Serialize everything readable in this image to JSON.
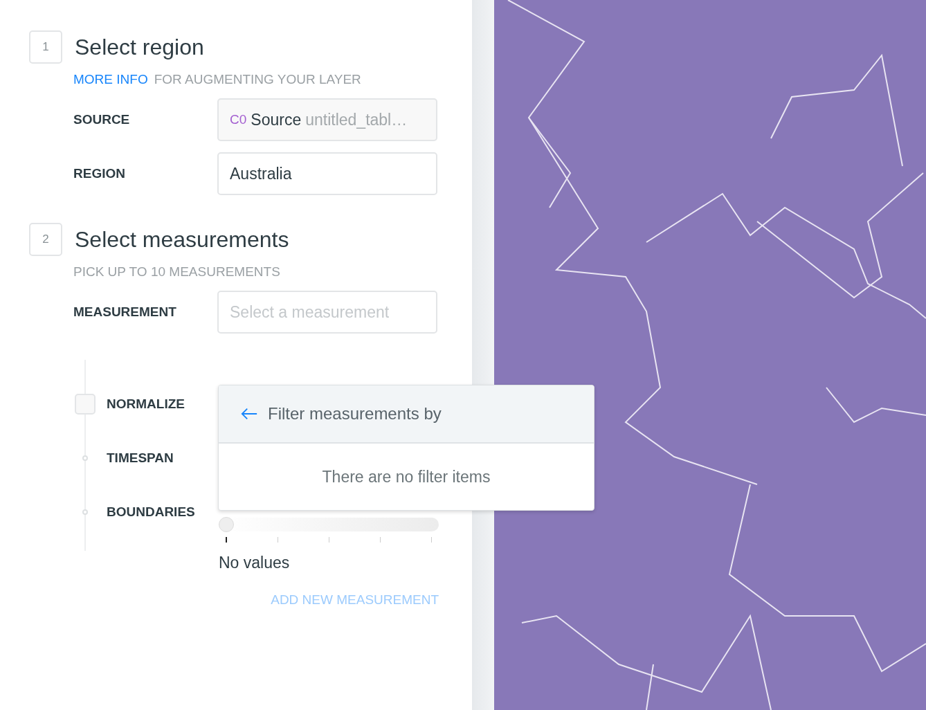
{
  "steps": [
    {
      "number": "1",
      "title": "Select region",
      "link": "MORE INFO",
      "subtitle": "FOR AUGMENTING YOUR LAYER",
      "fields": [
        {
          "label": "SOURCE",
          "kind": "source",
          "badge": "C0",
          "name": "Source",
          "value": "untitled_tabl…"
        },
        {
          "label": "REGION",
          "kind": "input",
          "value": "Australia"
        }
      ]
    },
    {
      "number": "2",
      "title": "Select measurements",
      "subtitle": "PICK UP TO 10 MEASUREMENTS",
      "fields": [
        {
          "label": "MEASUREMENT",
          "kind": "input",
          "placeholder": "Select a measurement"
        }
      ]
    }
  ],
  "options": [
    {
      "kind": "checkbox",
      "label": "NORMALIZE",
      "checked": false
    },
    {
      "kind": "dot",
      "label": "TIMESPAN"
    },
    {
      "kind": "dot",
      "label": "BOUNDARIES"
    }
  ],
  "boundaries_slider": {
    "level": 0,
    "caption": "No values"
  },
  "add_button": {
    "label": "ADD NEW MEASUREMENT",
    "disabled": true
  },
  "popup": {
    "title": "Filter measurements by",
    "empty": "There are no filter items"
  }
}
